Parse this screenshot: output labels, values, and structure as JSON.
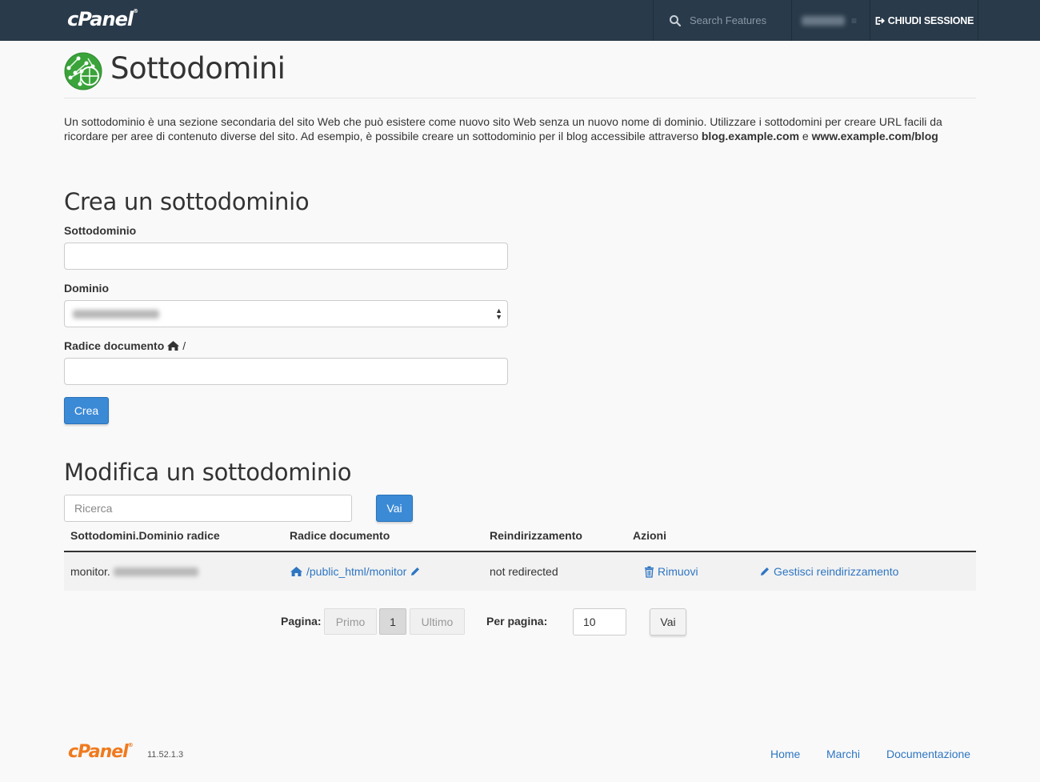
{
  "topbar": {
    "logo": "cPanel",
    "search_placeholder": "Search Features",
    "logout_label": "CHIUDI SESSIONE"
  },
  "page": {
    "title": "Sottodomini",
    "intro_part1": "Un sottodominio è una sezione secondaria del sito Web che può esistere come nuovo sito Web senza un nuovo nome di dominio. Utilizzare i sottodomini per creare URL facili da ricordare per aree di contenuto diverse del sito. Ad esempio, è possibile creare un sottodominio per il blog accessibile attraverso ",
    "intro_bold1": "blog.example.com",
    "intro_part2": " e ",
    "intro_bold2": "www.example.com/blog"
  },
  "create": {
    "heading": "Crea un sottodominio",
    "subdomain_label": "Sottodominio",
    "subdomain_value": "",
    "domain_label": "Dominio",
    "docroot_label": "Radice documento",
    "docroot_suffix": "/",
    "docroot_value": "",
    "submit_label": "Crea"
  },
  "manage": {
    "heading": "Modifica un sottodominio",
    "search_placeholder": "Ricerca",
    "search_button": "Vai",
    "columns": [
      "Sottodomini.Dominio radice",
      "Radice documento",
      "Reindirizzamento",
      "Azioni"
    ],
    "rows": [
      {
        "subdomain_prefix": "monitor.",
        "docroot": "/public_html/monitor",
        "redirect": "not redirected",
        "remove_label": "Rimuovi",
        "manage_redirect_label": "Gestisci reindirizzamento"
      }
    ]
  },
  "pagination": {
    "page_label": "Pagina:",
    "first_label": "Primo",
    "current_page": "1",
    "last_label": "Ultimo",
    "per_page_label": "Per pagina:",
    "per_page_value": "10",
    "go_label": "Vai"
  },
  "footer": {
    "logo": "cPanel",
    "version": "11.52.1.3",
    "links": [
      "Home",
      "Marchi",
      "Documentazione"
    ]
  },
  "colors": {
    "topbar": "#293a4a",
    "primary": "#3b8ad6",
    "link": "#2e76c2",
    "brand_orange": "#f07a1e"
  }
}
